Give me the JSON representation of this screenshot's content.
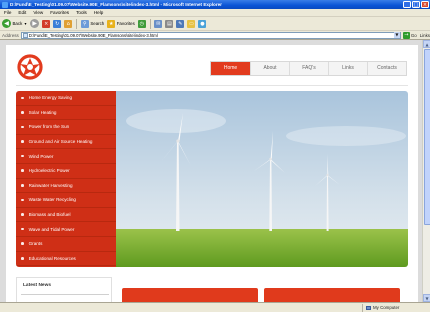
{
  "window": {
    "title": "D:\\Fund\\E_Testing\\01.09.07\\Website.90E_Flamsons\\site\\index-3.html - Microsoft Internet Explorer",
    "controls": [
      "_",
      "□",
      "×"
    ]
  },
  "menu": [
    "File",
    "Edit",
    "View",
    "Favorites",
    "Tools",
    "Help"
  ],
  "toolbar": {
    "back": "Back",
    "search": "Search",
    "favorites": "Favorites"
  },
  "address": {
    "label": "Address",
    "url": "D:\\Fund\\E_Testing\\01.09.07\\Website.90E_Flamsons\\site\\index-3.html",
    "go": "Go",
    "links": "Links"
  },
  "site": {
    "nav": [
      "Home",
      "About",
      "FAQ's",
      "Links",
      "Contacts"
    ],
    "active_nav": "Home",
    "sidebar": [
      "Home Energy Saving",
      "Solar Heating",
      "Power from the Sun",
      "Ground and Air Source Heating",
      "Wind Power",
      "Hydroelectric Power",
      "Rainwater Harvesting",
      "Waste Water Recycling",
      "Biomass and Biofuel",
      "Wave and Tidal Power",
      "Grants",
      "Educational Resources"
    ],
    "latest_news": "Latest News"
  },
  "status": {
    "zone": "My Computer"
  },
  "colors": {
    "accent": "#e23b1e",
    "sidebar": "#cf2f16",
    "titlebar": "#0a54d6"
  }
}
